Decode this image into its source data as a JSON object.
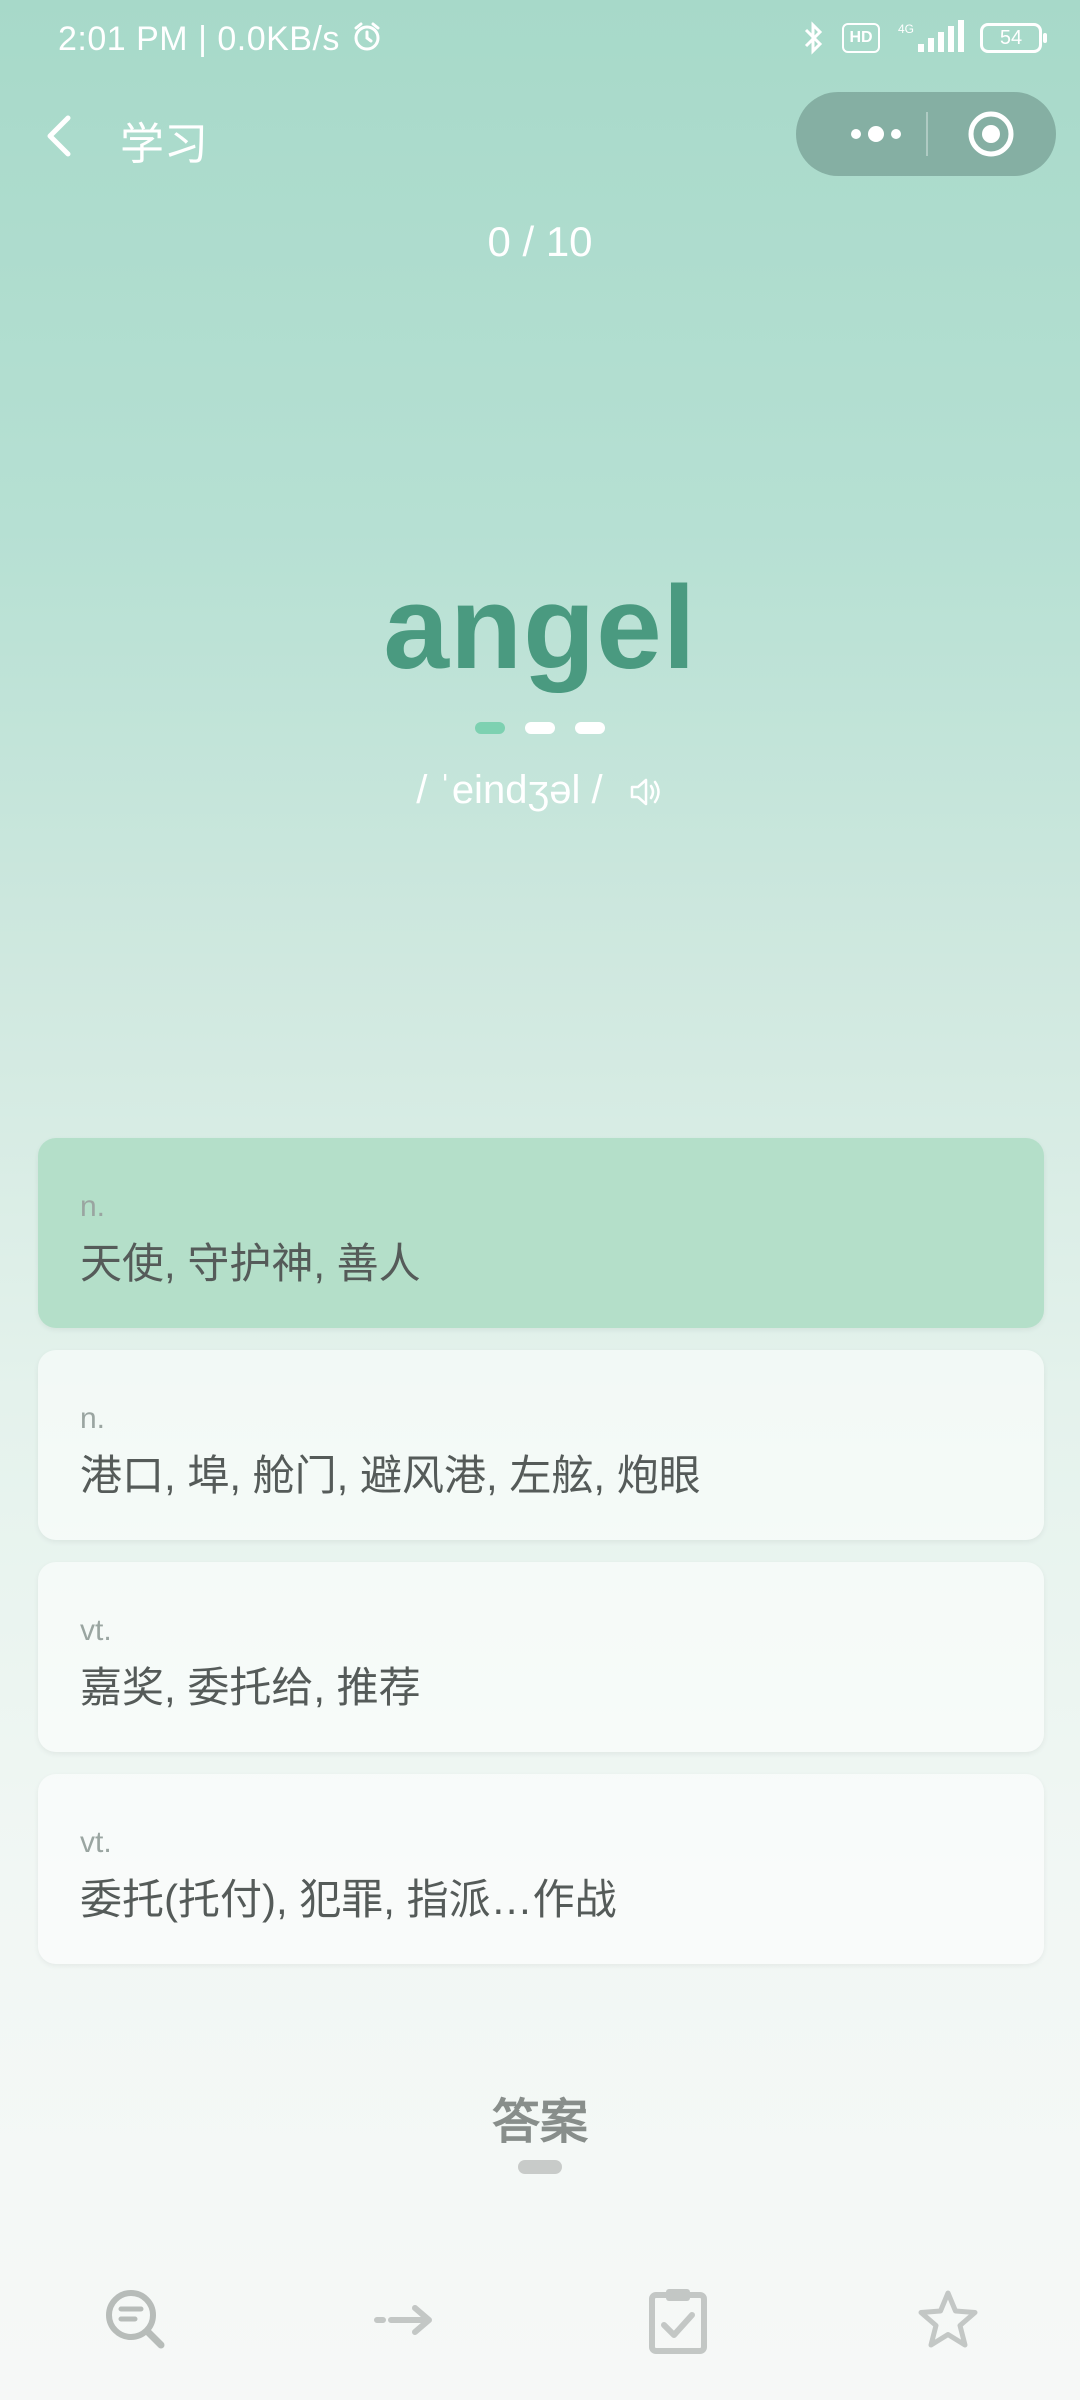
{
  "status_bar": {
    "time": "2:01 PM | 0.0KB/s",
    "network": "4G",
    "hd": "HD",
    "battery": "54"
  },
  "nav": {
    "title": "学习"
  },
  "progress": "0 / 10",
  "word": "angel",
  "phonetic": "/ ˈeindʒəl /",
  "options": [
    {
      "pos": "n.",
      "definition": "天使, 守护神, 善人",
      "selected": true
    },
    {
      "pos": "n.",
      "definition": "港口, 埠, 舱门, 避风港, 左舷, 炮眼",
      "selected": false
    },
    {
      "pos": "vt.",
      "definition": "嘉奖, 委托给, 推荐",
      "selected": false
    },
    {
      "pos": "vt.",
      "definition": "委托(托付), 犯罪, 指派…作战",
      "selected": false
    }
  ],
  "answer_label": "答案",
  "colors": {
    "accent": "#4a9a80",
    "selected_option": "#b4dfc9",
    "active_dot": "#7dd1b1"
  },
  "icons": [
    "back-icon",
    "more-icon",
    "close-target-icon",
    "speaker-icon",
    "search-list-icon",
    "arrow-right-icon",
    "clipboard-check-icon",
    "star-icon"
  ]
}
